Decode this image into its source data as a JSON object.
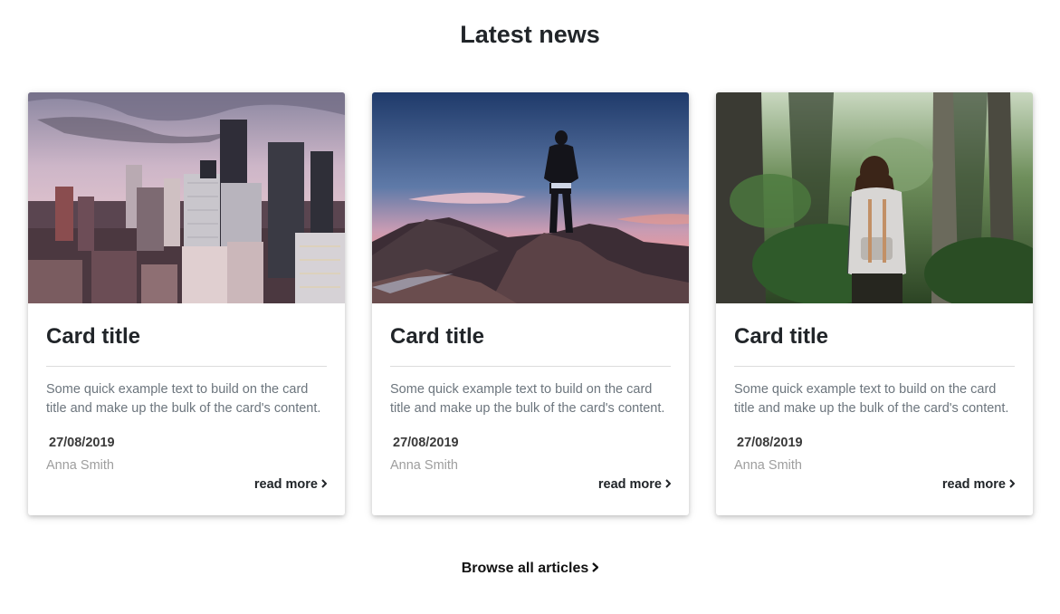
{
  "section": {
    "title": "Latest news"
  },
  "cards": [
    {
      "image_subject": "city skyline at dusk",
      "title": "Card title",
      "text": "Some quick example text to build on the card title and make up the bulk of the card's content.",
      "date": "27/08/2019",
      "author": "Anna Smith",
      "read_more_label": "read more"
    },
    {
      "image_subject": "hiker on mountain summit at sunset",
      "title": "Card title",
      "text": "Some quick example text to build on the card title and make up the bulk of the card's content.",
      "date": "27/08/2019",
      "author": "Anna Smith",
      "read_more_label": "read more"
    },
    {
      "image_subject": "hiker with backpack in forest",
      "title": "Card title",
      "text": "Some quick example text to build on the card title and make up the bulk of the card's content.",
      "date": "27/08/2019",
      "author": "Anna Smith",
      "read_more_label": "read more"
    }
  ],
  "browse": {
    "label": "Browse all articles"
  },
  "colors": {
    "heading": "#212529",
    "body_text": "#6c757d",
    "author_text": "#9e9e9e",
    "divider": "#dcdcdc"
  }
}
